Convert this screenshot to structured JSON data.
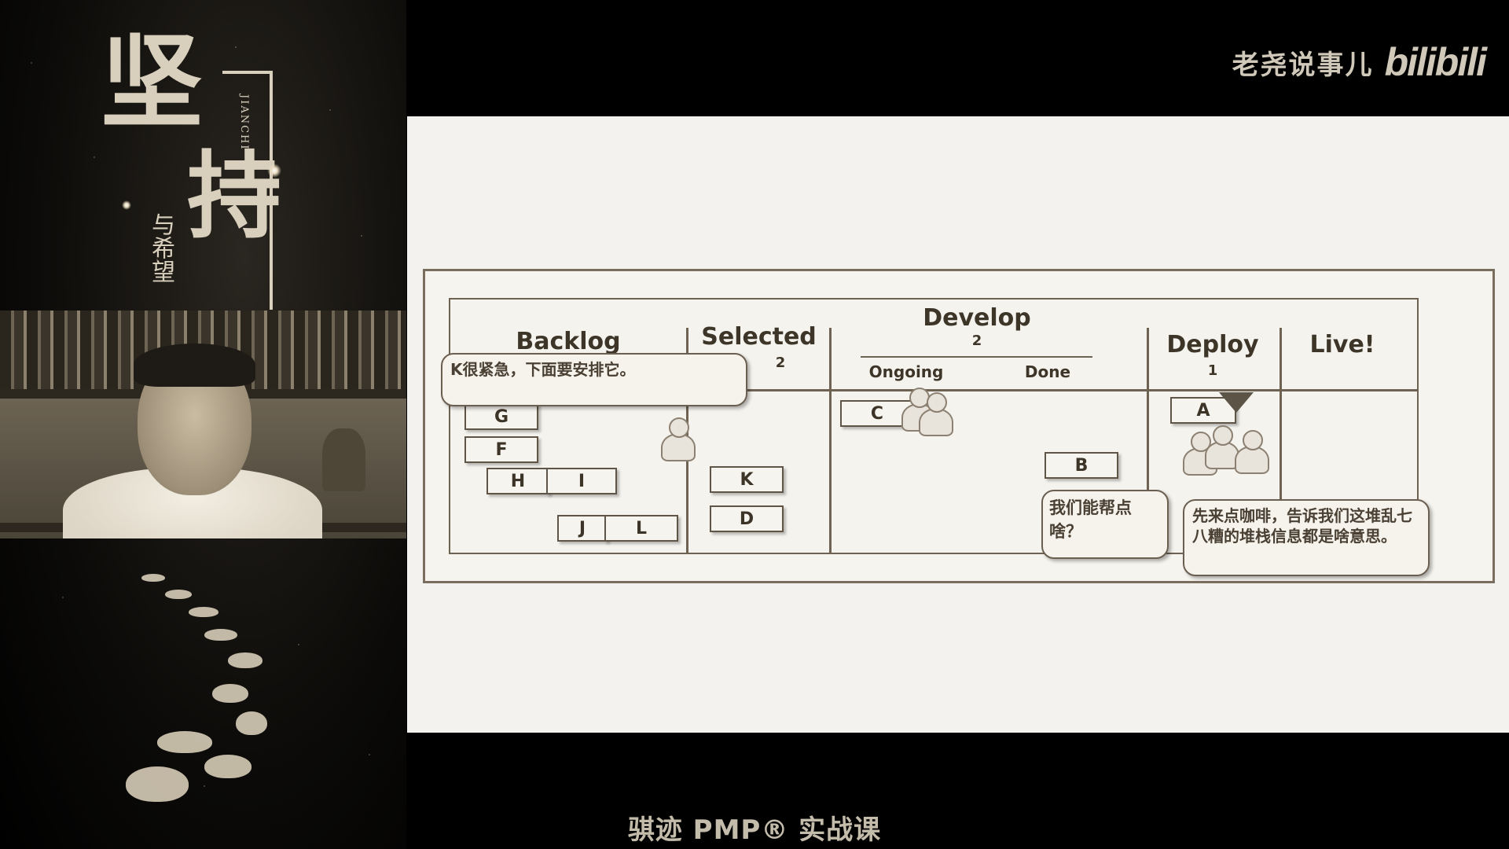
{
  "left_panel": {
    "calligraphy_main_1": "坚",
    "calligraphy_main_2": "持",
    "pinyin": "JIANCHI",
    "subtitle": "与希望"
  },
  "brand": {
    "channel_name": "老尧说事儿",
    "logo_text": "bilibili"
  },
  "board": {
    "columns": {
      "backlog": "Backlog",
      "selected": "Selected",
      "selected_wip": "2",
      "develop": "Develop",
      "develop_wip": "2",
      "ongoing": "Ongoing",
      "done": "Done",
      "deploy": "Deploy",
      "deploy_wip": "1",
      "live": "Live!"
    },
    "cards": {
      "g": "G",
      "f": "F",
      "h": "H",
      "i": "I",
      "j": "J",
      "l": "L",
      "k": "K",
      "d": "D",
      "c": "C",
      "b": "B",
      "a": "A"
    },
    "bubbles": {
      "backlog_note": "K很紧急，下面要安排它。",
      "help_offer": "我们能帮点啥？",
      "coffee_note": "先来点咖啡，告诉我们这堆乱七八糟的堆栈信息都是啥意思。"
    }
  },
  "footer": {
    "title": "骐迹 PMP® 实战课"
  }
}
